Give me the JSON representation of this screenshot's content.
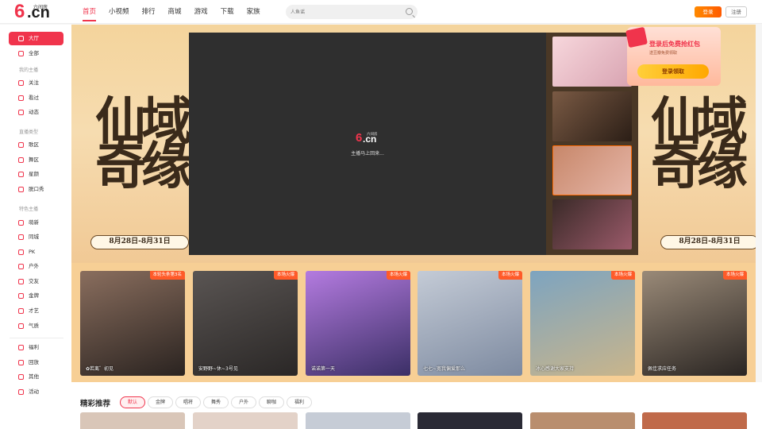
{
  "header": {
    "logo_text": "6.cn",
    "logo_sub": "六间房",
    "nav": [
      "首页",
      "小视频",
      "排行",
      "商城",
      "游戏",
      "下载",
      "家族"
    ],
    "search_placeholder": "人鱼谣",
    "login_label": "登录",
    "register_label": "注册"
  },
  "sidebar": {
    "hall": "大厅",
    "all": "全部",
    "group_mine": "我的主播",
    "follow": "关注",
    "watched": "看过",
    "dynamic": "动态",
    "group_type": "直播类型",
    "sing": "歌区",
    "dance": "舞区",
    "looks": "星颜",
    "talk": "脱口秀",
    "group_feature": "特色主播",
    "newbie": "萌新",
    "city": "同城",
    "pk": "PK",
    "outdoor": "户外",
    "friend": "交友",
    "gold": "金牌",
    "talent": "才艺",
    "temperament": "气质",
    "welfare": "福利",
    "replay": "回放",
    "other": "其他",
    "activity": "活动"
  },
  "banner": {
    "left_text": "仙域奇缘",
    "date": "8月28日-8月31日",
    "right_text": "仙域奇缘"
  },
  "player": {
    "logo_text": "6.cn",
    "logo_sub": "六间房",
    "message": "主播马上回来..."
  },
  "promo": {
    "title": "登录后免费抢红包",
    "subtitle": "送豆瓣免费领取",
    "button": "登录领取"
  },
  "cards": [
    {
      "badge": "本轮头条第3名",
      "name": "✿若离゛初见"
    },
    {
      "badge": "本场火爆",
      "name": "安野野~休~3号见"
    },
    {
      "badge": "本场火爆",
      "name": "诺诺第一天"
    },
    {
      "badge": "本场火爆",
      "name": "七七~宽我偏爱那么"
    },
    {
      "badge": "本场火爆",
      "name": "冰心感谢大家支持"
    },
    {
      "badge": "本场火爆",
      "name": "佩佳求应任务"
    }
  ],
  "section": {
    "title": "精彩推荐",
    "tags": [
      "默认",
      "金牌",
      "唱将",
      "舞秀",
      "户外",
      "聊咖",
      "福利"
    ]
  },
  "colors": {
    "accent": "#f0344c",
    "login": "#ff7a00",
    "badge": "#ff5b29"
  }
}
